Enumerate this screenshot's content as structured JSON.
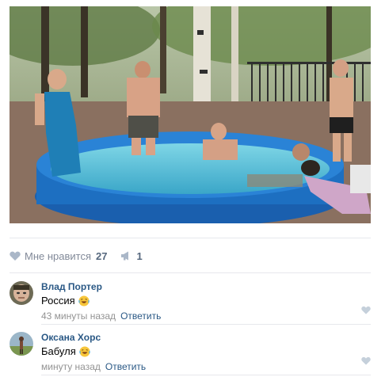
{
  "post": {
    "photo": {
      "description_icon": "photo"
    },
    "likes": {
      "label": "Мне нравится",
      "count": "27"
    },
    "shares": {
      "count": "1"
    }
  },
  "comments": [
    {
      "author": "Влад Портер",
      "text": "Россия",
      "time": "43 минуты назад",
      "reply": "Ответить"
    },
    {
      "author": "Оксана Хорс",
      "text": "Бабуля",
      "time": "минуту назад",
      "reply": "Ответить"
    }
  ],
  "colors": {
    "link": "#2a5885",
    "muted": "#828a99",
    "divider": "#e7e8ec",
    "pool": "#1d6fc1"
  }
}
